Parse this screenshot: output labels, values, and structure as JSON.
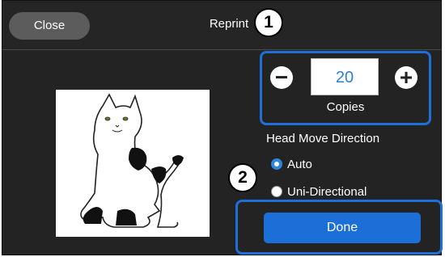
{
  "header": {
    "close_label": "Close",
    "title": "Reprint"
  },
  "callouts": {
    "one": "1",
    "two": "2"
  },
  "copies": {
    "value": "20",
    "label": "Copies",
    "decrement_icon": "minus-icon",
    "increment_icon": "plus-icon"
  },
  "head_move": {
    "label": "Head Move Direction",
    "options": [
      {
        "label": "Auto",
        "selected": true
      },
      {
        "label": "Uni-Directional",
        "selected": false
      }
    ]
  },
  "done_label": "Done",
  "colors": {
    "accent": "#1e6fd9",
    "background": "#232323",
    "close_button": "#5c5c5c"
  }
}
